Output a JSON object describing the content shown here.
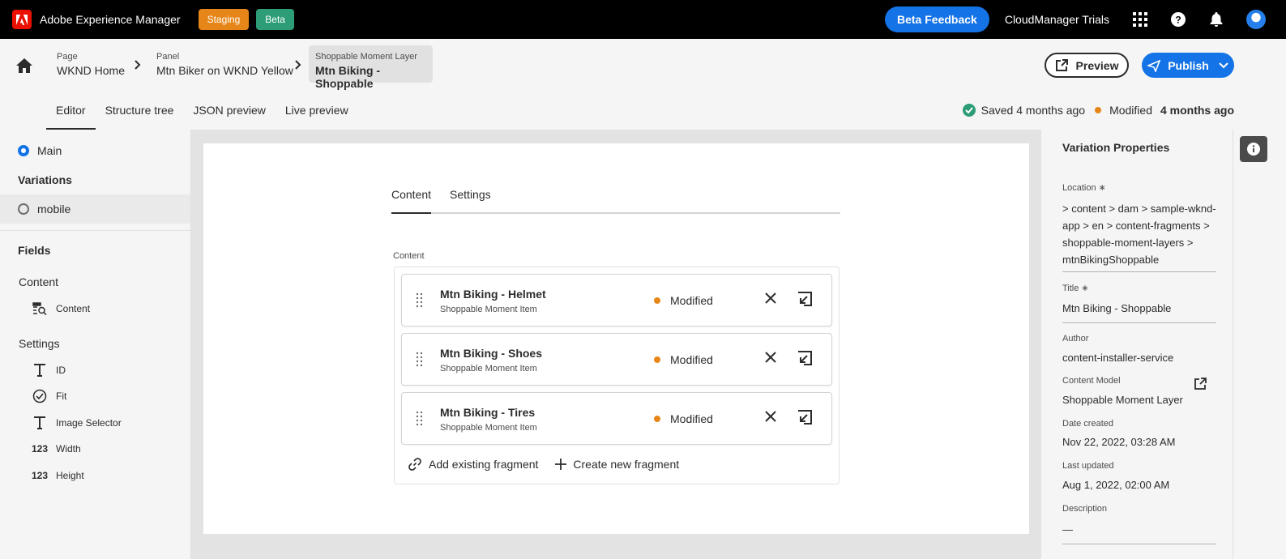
{
  "topbar": {
    "app_title": "Adobe Experience Manager",
    "badges": [
      "Staging",
      "Beta"
    ],
    "beta_feedback": "Beta Feedback",
    "org_name": "CloudManager Trials"
  },
  "breadcrumbs": [
    {
      "label": "Page",
      "value": "WKND Home"
    },
    {
      "label": "Panel",
      "value": "Mtn Biker on WKND Yellow"
    },
    {
      "label": "Shoppable Moment Layer",
      "value": "Mtn Biking - Shoppable"
    }
  ],
  "actions": {
    "preview": "Preview",
    "publish": "Publish"
  },
  "tabs": [
    "Editor",
    "Structure tree",
    "JSON preview",
    "Live preview"
  ],
  "status": {
    "saved": "Saved 4 months ago",
    "modified_label": "Modified",
    "modified_time": "4 months ago"
  },
  "left_panel": {
    "main": "Main",
    "variations_title": "Variations",
    "variations": [
      "mobile"
    ],
    "fields_title": "Fields",
    "content_group": "Content",
    "content_fields": [
      {
        "icon": "fragment-search-icon",
        "label": "Content"
      }
    ],
    "settings_group": "Settings",
    "settings_fields": [
      {
        "icon": "text-type-icon",
        "label": "ID"
      },
      {
        "icon": "check-circle-icon",
        "label": "Fit"
      },
      {
        "icon": "text-type-icon",
        "label": "Image Selector"
      },
      {
        "icon": "number-type-icon",
        "label": "Width",
        "glyph": "123"
      },
      {
        "icon": "number-type-icon",
        "label": "Height",
        "glyph": "123"
      }
    ]
  },
  "editor": {
    "tabs": [
      "Content",
      "Settings"
    ],
    "content_label": "Content",
    "fragments": [
      {
        "title": "Mtn Biking - Helmet",
        "subtitle": "Shoppable Moment Item",
        "status": "Modified"
      },
      {
        "title": "Mtn Biking - Shoes",
        "subtitle": "Shoppable Moment Item",
        "status": "Modified"
      },
      {
        "title": "Mtn Biking - Tires",
        "subtitle": "Shoppable Moment Item",
        "status": "Modified"
      }
    ],
    "add_existing": "Add existing fragment",
    "create_new": "Create new fragment"
  },
  "right_panel": {
    "title": "Variation Properties",
    "location_label": "Location ∗",
    "location_value": " > content > dam > sample-wknd-app > en > content-fragments > shoppable-moment-layers > mtnBikingShoppable",
    "title_label": "Title ∗",
    "title_value": "Mtn Biking - Shoppable",
    "author_label": "Author",
    "author_value": "content-installer-service",
    "model_label": "Content Model",
    "model_value": "Shoppable Moment Layer",
    "created_label": "Date created",
    "created_value": "Nov 22, 2022, 03:28 AM",
    "updated_label": "Last updated",
    "updated_value": "Aug 1, 2022, 02:00 AM",
    "description_label": "Description",
    "description_value": "—"
  },
  "colors": {
    "accent": "#1473e6",
    "staging": "#e68619",
    "beta": "#2d9d78",
    "modified_dot": "#e68619"
  }
}
